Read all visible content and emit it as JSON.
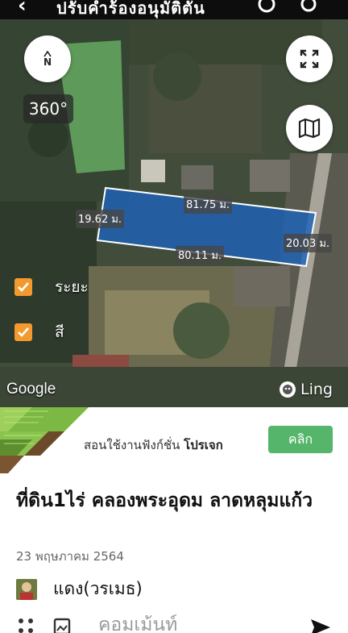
{
  "topbar": {
    "back_glyph": "‹",
    "title": "ปรับคำร้องอนุมัติตัน"
  },
  "map": {
    "compass_label": "N",
    "btn_360": "360°",
    "distances": {
      "top": "81.75 ม.",
      "left": "19.62 ม.",
      "bottom": "80.11 ม.",
      "right": "20.03 ม."
    },
    "layers": [
      {
        "label": "ระยะ",
        "checked": true
      },
      {
        "label": "สี",
        "checked": true
      }
    ],
    "google_logo": "Google",
    "ling_logo": "Ling",
    "colors": {
      "parcel_fill": "#1f63b8",
      "parcel_stroke": "#ffffff",
      "checkbox": "#f29a2e"
    }
  },
  "banner": {
    "text_prefix": "สอนใช้งานฟังก์ชั่น",
    "text_bold": "โปรเจก",
    "button": "คลิก",
    "colors": {
      "button": "#55b56a"
    }
  },
  "post": {
    "title": "ที่ดิน1ไร่ คลองพระอุดม ลาดหลุมแก้ว",
    "date": "23 พฤษภาคม 2564",
    "author": "แดง(วรเมธ)"
  },
  "comment_bar": {
    "placeholder": "คอมเม้นท์"
  }
}
